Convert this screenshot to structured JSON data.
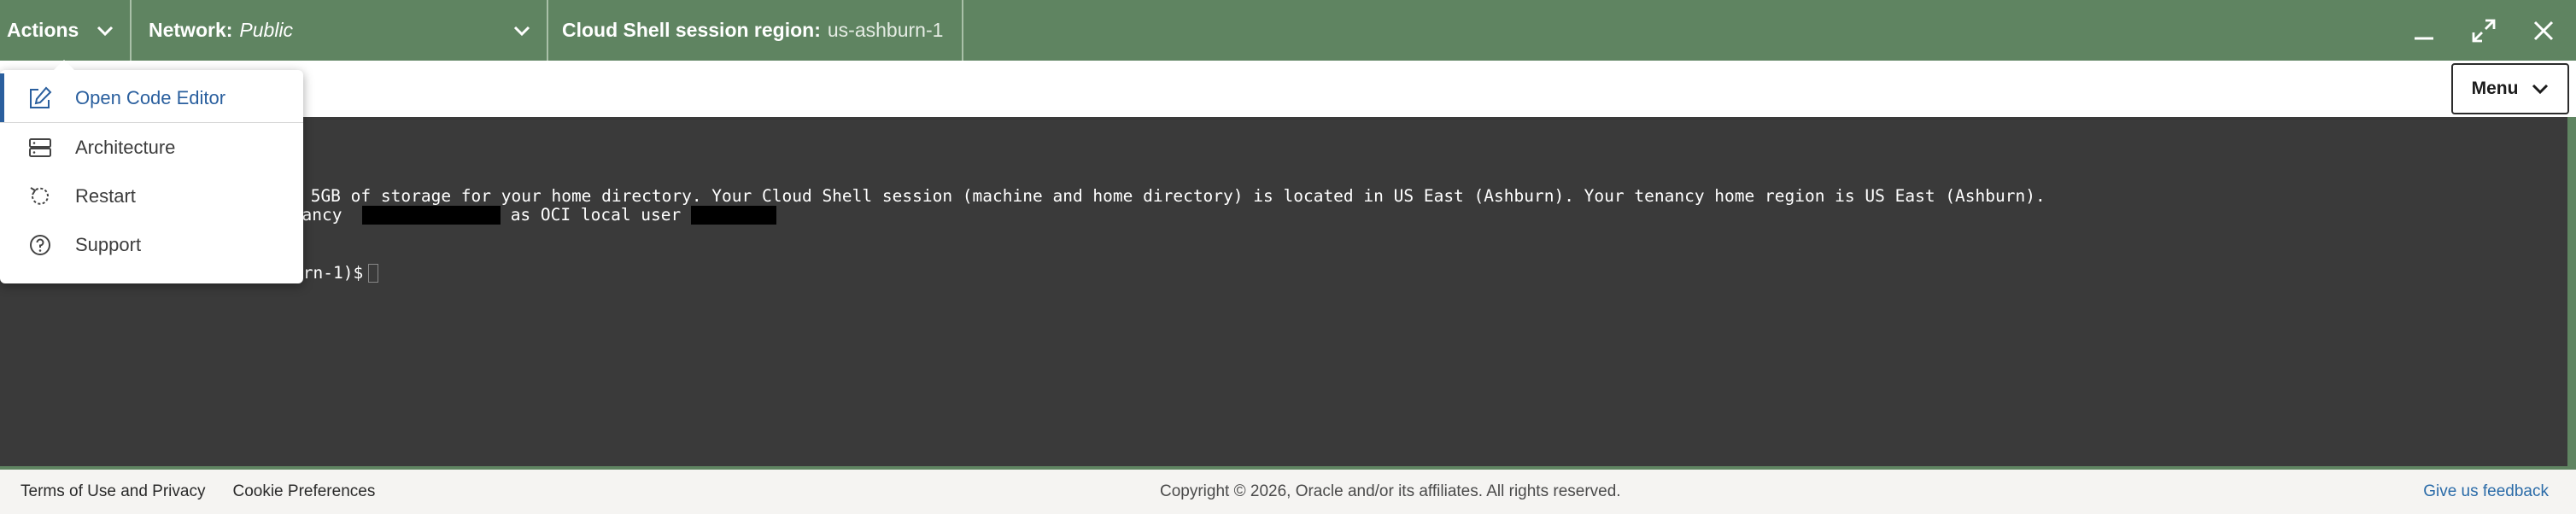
{
  "topbar": {
    "actions_label": "Actions",
    "network_label": "Network:",
    "network_value": "Public",
    "region_label": "Cloud Shell session region:",
    "region_value": "us-ashburn-1",
    "icons": [
      "chevron-down-icon",
      "minimize-icon",
      "maximize-icon",
      "close-icon"
    ]
  },
  "toolbar": {
    "menu_label": "Menu"
  },
  "actions_menu": {
    "items": [
      {
        "label": "Open Code Editor",
        "icon": "edit-icon",
        "active": true
      },
      {
        "label": "Architecture",
        "icon": "server-icon",
        "active": false
      },
      {
        "label": "Restart",
        "icon": "restart-icon",
        "active": false
      },
      {
        "label": "Support",
        "icon": "help-icon",
        "active": false
      }
    ]
  },
  "terminal": {
    "line1": "with 5GB of storage for your home directory. Your Cloud Shell session (machine and home directory) is located in US East (Ashburn). Your tenancy home region is US East (Ashburn).",
    "line2_a": "enancy",
    "line2_b": "as OCI local user",
    "prompt": "urn-1)$"
  },
  "footer": {
    "terms": "Terms of Use and Privacy",
    "cookies": "Cookie Preferences",
    "copyright": "Copyright © 2026, Oracle and/or its affiliates. All rights reserved.",
    "feedback": "Give us feedback"
  },
  "colors": {
    "topbar_bg": "#5f8461",
    "terminal_bg": "#3a3a3a",
    "accent_blue": "#2a5f9e",
    "link_blue": "#2a6ba8"
  }
}
